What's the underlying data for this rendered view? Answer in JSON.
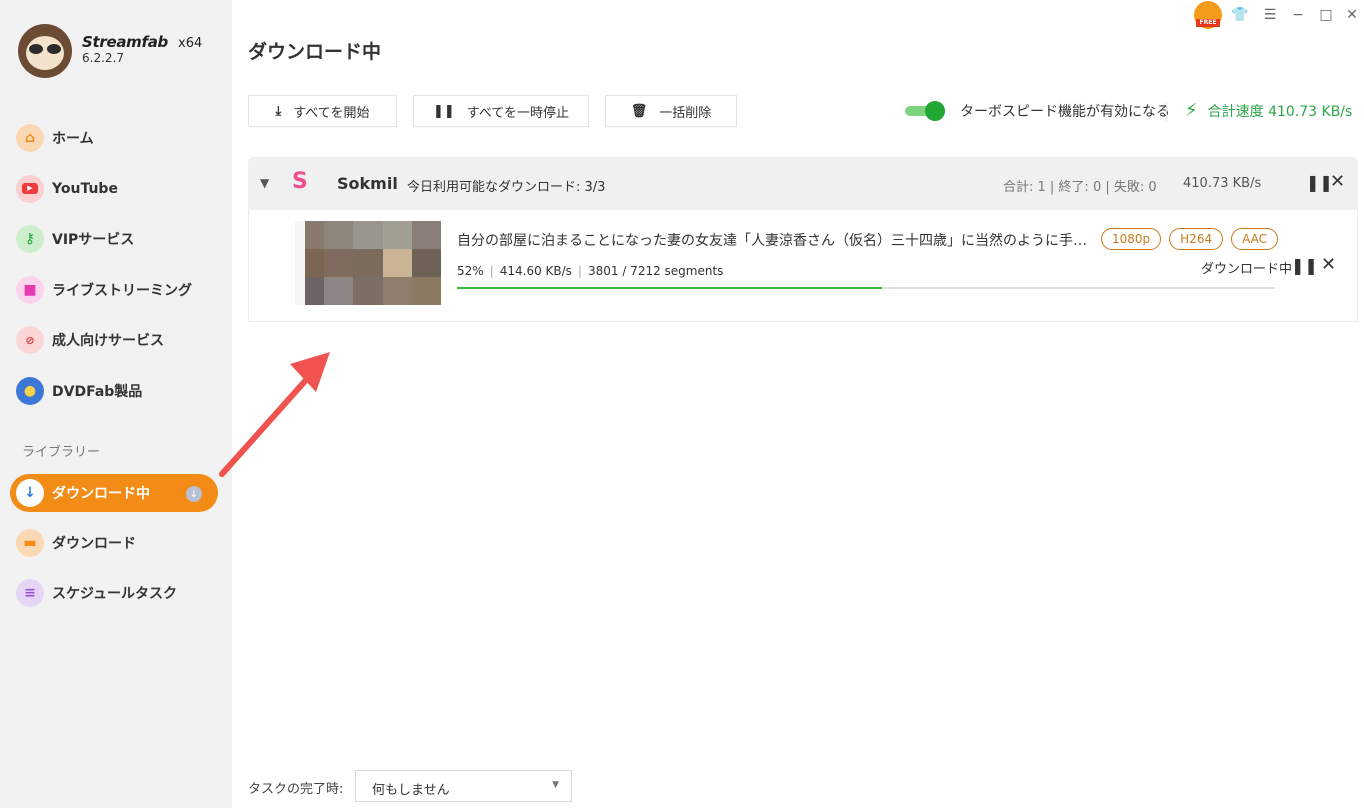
{
  "app": {
    "name": "Streamfab",
    "arch": "x64",
    "version": "6.2.2.7",
    "free_badge": "FREE"
  },
  "sidebar": {
    "items": [
      {
        "label": "ホーム",
        "icon": "home-icon"
      },
      {
        "label": "YouTube",
        "icon": "youtube-icon"
      },
      {
        "label": "VIPサービス",
        "icon": "key-icon"
      },
      {
        "label": "ライブストリーミング",
        "icon": "camera-icon"
      },
      {
        "label": "成人向けサービス",
        "icon": "adult-icon"
      },
      {
        "label": "DVDFab製品",
        "icon": "dvdfab-icon"
      }
    ],
    "library_label": "ライブラリー",
    "library": [
      {
        "label": "ダウンロード中",
        "icon": "download-icon",
        "active": true
      },
      {
        "label": "ダウンロード",
        "icon": "folder-icon"
      },
      {
        "label": "スケジュールタスク",
        "icon": "schedule-icon"
      }
    ]
  },
  "main": {
    "title": "ダウンロード中",
    "toolbar": {
      "start_all": "すべてを開始",
      "pause_all": "すべてを一時停止",
      "delete_all": "一括削除"
    },
    "turbo_label": "ターボスピード機能が有効になる",
    "turbo_on": true,
    "total_speed": "合計速度 410.73 KB/s"
  },
  "group": {
    "site_logo": "S",
    "site_name": "Sokmil",
    "quota": "今日利用可能なダウンロード: 3/3",
    "stats": "合計: 1 | 終了: 0 | 失敗: 0",
    "speed": "410.73 KB/s"
  },
  "item": {
    "title": "自分の部屋に泊まることになった妻の女友達「人妻涼香さん（仮名）三十四歳」に当然のように手を出…",
    "tags": [
      "1080p",
      "H264",
      "AAC"
    ],
    "percent": "52%",
    "speed": "414.60 KB/s",
    "segments": "3801 / 7212 segments",
    "progress": 0.52,
    "status": "ダウンロード中"
  },
  "footer": {
    "label": "タスクの完了時:",
    "select_value": "何もしません"
  },
  "colors": {
    "accent": "#f28c17",
    "progress": "#2fbf3a",
    "speed_green": "#2aa64a",
    "tag": "#c77a1c",
    "site_pink": "#ef4f8c"
  }
}
